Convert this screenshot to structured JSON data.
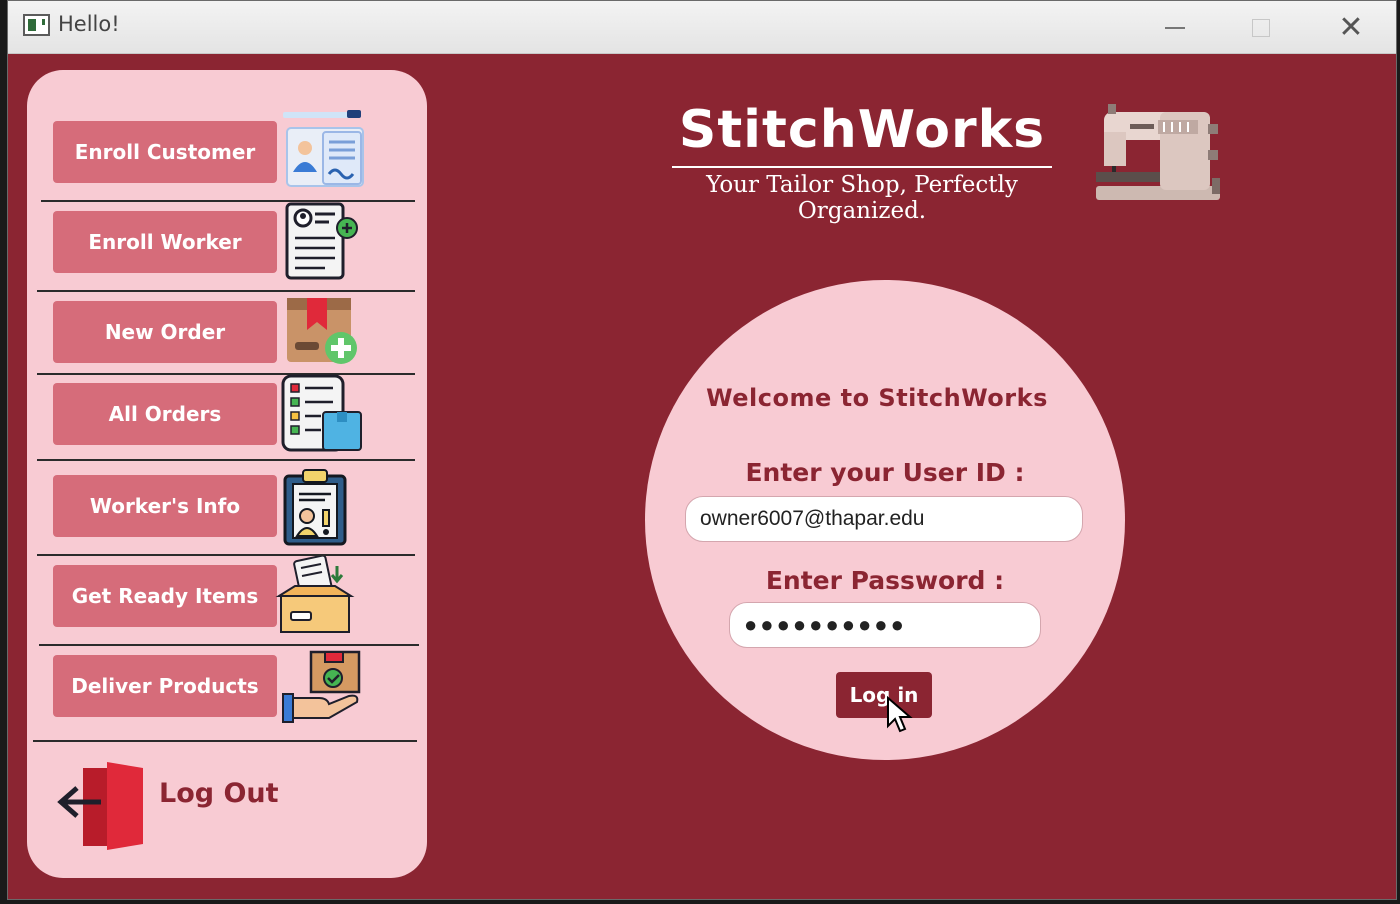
{
  "window": {
    "title": "Hello!"
  },
  "sidebar": {
    "items": [
      {
        "label": "Enroll Customer",
        "icon": "id-card-icon"
      },
      {
        "label": "Enroll Worker",
        "icon": "worker-resume-icon"
      },
      {
        "label": "New Order",
        "icon": "new-package-icon"
      },
      {
        "label": "All Orders",
        "icon": "order-checklist-icon"
      },
      {
        "label": "Worker's Info",
        "icon": "clipboard-worker-icon"
      },
      {
        "label": "Get Ready Items",
        "icon": "box-download-icon"
      },
      {
        "label": "Deliver Products",
        "icon": "hand-delivery-icon"
      }
    ],
    "logout_label": "Log Out"
  },
  "brand": {
    "title": "StitchWorks",
    "subtitle": "Your Tailor Shop, Perfectly Organized."
  },
  "login": {
    "welcome": "Welcome to StitchWorks",
    "user_label": "Enter your User ID :",
    "user_value": "owner6007@thapar.edu",
    "password_label": "Enter Password :",
    "password_value": "●●●●●●●●●●",
    "button_label": "Log in"
  },
  "colors": {
    "background": "#8b2532",
    "panel": "#f8cbd3",
    "nav_button": "#d66c7a",
    "accent": "#8b2532"
  }
}
